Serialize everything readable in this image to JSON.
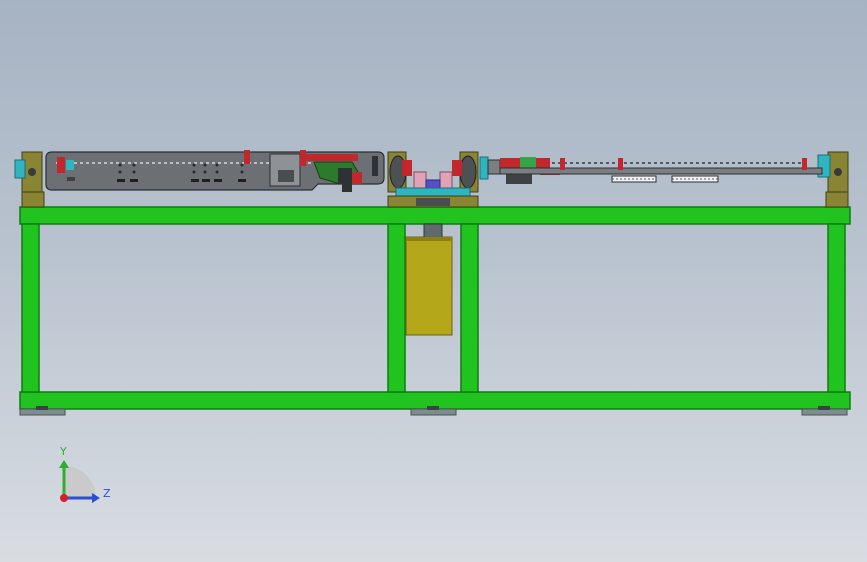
{
  "view": {
    "colors": {
      "frame_green": "#21c41f",
      "frame_green_dark": "#0f7d10",
      "hopper_olive": "#b4a71a",
      "rail_gray": "#6c6f73",
      "accent_red": "#c1272d",
      "accent_teal": "#2fb5c0",
      "bracket_olive": "#8a8435"
    }
  },
  "triad": {
    "y_label": "Y",
    "z_label": "Z",
    "y_color": "#2fae2f",
    "z_color": "#2b4fd0",
    "origin_color": "#d0202a"
  }
}
